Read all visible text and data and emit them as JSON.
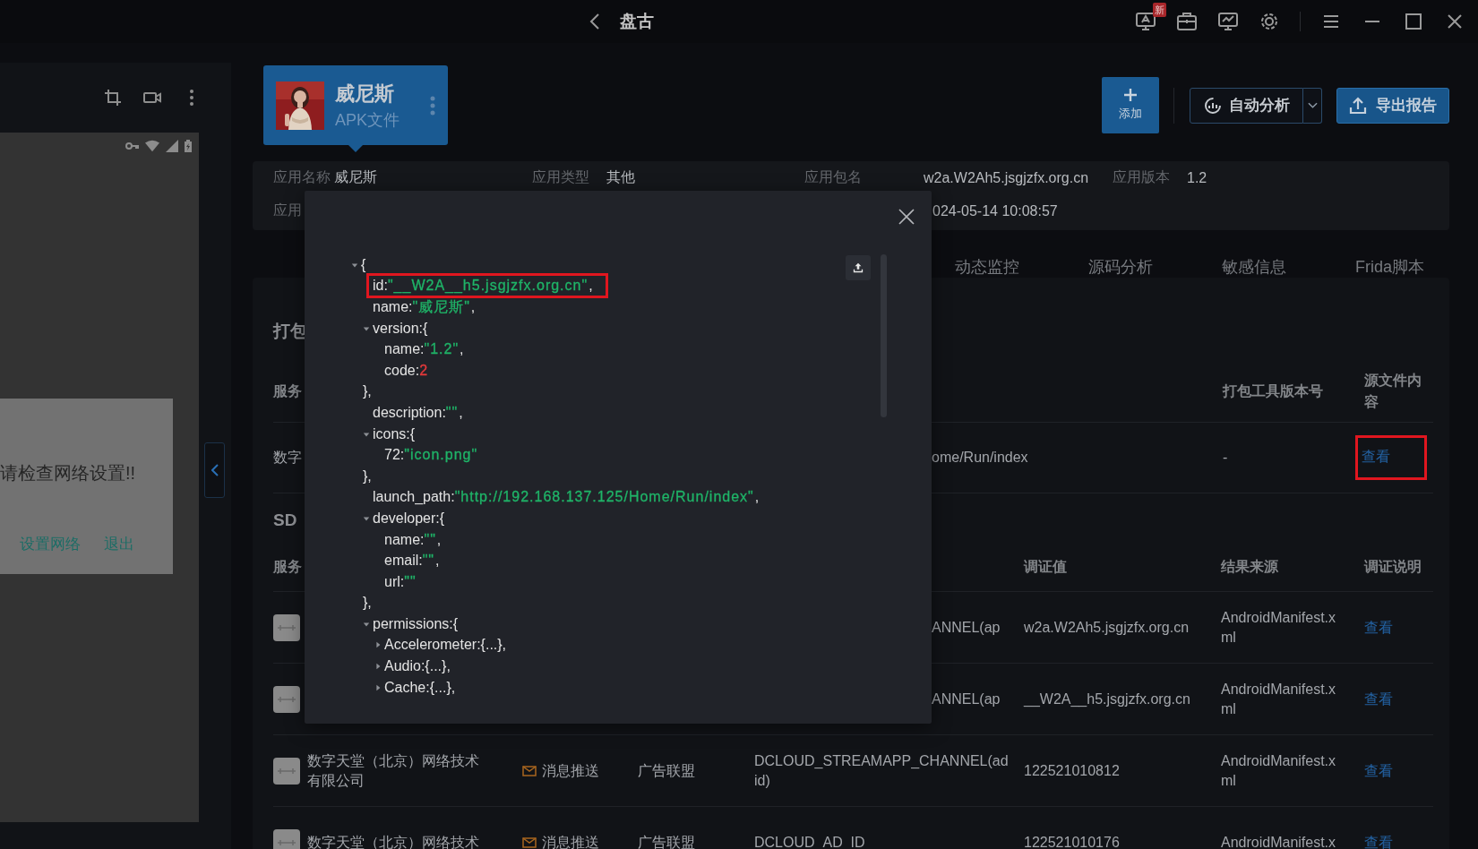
{
  "title_bar": {
    "title": "盘古",
    "notice_badge": "新"
  },
  "device_screen": {
    "dialog": {
      "message": "请检查网络设置!!",
      "buttons": [
        "设置网络",
        "退出"
      ]
    }
  },
  "app_card": {
    "name": "威尼斯",
    "type": "APK文件"
  },
  "actions": {
    "add": "添加",
    "auto_analysis": "自动分析",
    "export_report": "导出报告"
  },
  "app_info": {
    "row_1": [
      {
        "label": "应用名称",
        "value": "威尼斯"
      },
      {
        "label": "应用类型",
        "value": "其他"
      },
      {
        "label": "应用包名",
        "value": "w2a.W2Ah5.jsgjzfx.org.cn"
      },
      {
        "label": "应用版本",
        "value": "1.2"
      }
    ],
    "row_2": {
      "label": "应用",
      "value": "024-05-14 10:08:57"
    }
  },
  "tabs": [
    {
      "label": "动态监控"
    },
    {
      "label": "源码分析"
    },
    {
      "label": "敏感信息"
    },
    {
      "label": "Frida脚本"
    }
  ],
  "packaging": {
    "title": "打包",
    "columns": [
      "服务",
      "打包工具版本号",
      "源文件内容"
    ],
    "rows": [
      {
        "column_1": "数字",
        "launch_path": "ome/Run/index",
        "tool_version": "-",
        "link": "查看",
        "marked": true
      }
    ]
  },
  "sdk": {
    "title": "SD",
    "columns": [
      "服务",
      "调证值",
      "结果来源",
      "调证说明"
    ],
    "rows": [
      {
        "covered": true,
        "key": "ANNEL(ap",
        "value": "w2a.W2Ah5.jsgjzfx.org.cn",
        "source": "AndroidManifest.xml",
        "link": "查看"
      },
      {
        "covered": true,
        "key": "ANNEL(ap",
        "value": "__W2A__h5.jsgjzfx.org.cn",
        "source": "AndroidManifest.xml",
        "link": "查看"
      },
      {
        "covered": false,
        "company": "数字天堂（北京）网络技术有限公司",
        "type": "消息推送",
        "category": "广告联盟",
        "key": "DCLOUD_STREAMAPP_CHANNEL(adid)",
        "value": "122521010812",
        "source": "AndroidManifest.xml",
        "link": "查看"
      },
      {
        "covered": false,
        "company": "数字天堂（北京）网络技术",
        "type": "消息推送",
        "category": "广告联盟",
        "key": "DCLOUD_AD_ID",
        "value": "122521010176",
        "source": "AndroidManifest.x",
        "link": "查看"
      }
    ]
  },
  "manifest_viewer": {
    "tree": {
      "kind": "object",
      "open": "{",
      "expanded": true,
      "children": [
        {
          "kind": "pair",
          "key": "id:",
          "value": "\"__W2A__h5.jsgjzfx.org.cn\"",
          "color": "#1fb468",
          "tail": ",",
          "marked": true
        },
        {
          "kind": "pair",
          "key": "name:",
          "value": "\"威尼斯\"",
          "color": "#1fb468",
          "tail": ",",
          "marked": false
        },
        {
          "kind": "object",
          "key": "version:",
          "open": "{",
          "expanded": true,
          "close": "},",
          "children": [
            {
              "kind": "pair",
              "key": "name:",
              "value": "\"1.2\"",
              "color": "#1fb468",
              "tail": ",",
              "marked": false
            },
            {
              "kind": "pair",
              "key": "code:",
              "value": "2",
              "color": "#e5393b",
              "marked": false
            }
          ]
        },
        {
          "kind": "pair",
          "key": "description:",
          "value": "\"\"",
          "color": "#1fb468",
          "tail": ",",
          "marked": false
        },
        {
          "kind": "object",
          "key": "icons:",
          "open": "{",
          "expanded": true,
          "close": "},",
          "children": [
            {
              "kind": "pair",
              "key": "72:",
              "value": "\"icon.png\"",
              "color": "#1fb468",
              "marked": false
            }
          ]
        },
        {
          "kind": "pair",
          "key": "launch_path:",
          "value": "\"http://192.168.137.125/Home/Run/index\"",
          "color": "#1fb468",
          "tail": ",",
          "marked": false
        },
        {
          "kind": "object",
          "key": "developer:",
          "open": "{",
          "expanded": true,
          "close": "},",
          "children": [
            {
              "kind": "pair",
              "key": "name:",
              "value": "\"\"",
              "color": "#1fb468",
              "tail": ",",
              "marked": false
            },
            {
              "kind": "pair",
              "key": "email:",
              "value": "\"\"",
              "color": "#1fb468",
              "tail": ",",
              "marked": false
            },
            {
              "kind": "pair",
              "key": "url:",
              "value": "\"\"",
              "color": "#1fb468",
              "marked": false
            }
          ]
        },
        {
          "kind": "object",
          "key": "permissions:",
          "open": "{",
          "expanded": true,
          "children": [
            {
              "kind": "object",
              "key": "Accelerometer:",
              "summary": "{...},",
              "expanded": false
            },
            {
              "kind": "object",
              "key": "Audio:",
              "summary": "{...},",
              "expanded": false
            },
            {
              "kind": "object",
              "key": "Cache:",
              "summary": "{...},",
              "expanded": false
            }
          ]
        }
      ]
    }
  }
}
